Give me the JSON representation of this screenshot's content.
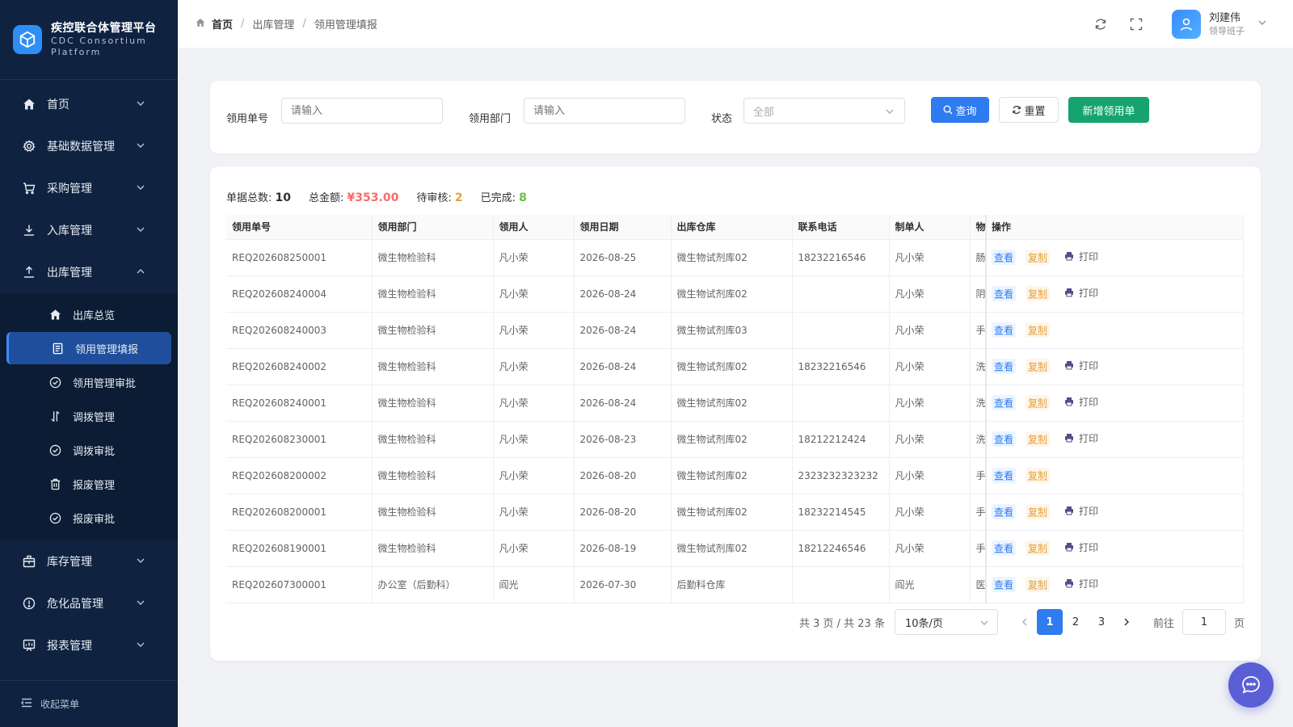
{
  "brand": {
    "title": "疾控联合体管理平台",
    "subtitle_line1": "CDC Consortium",
    "subtitle_line2": "Platform",
    "icon": "cube-icon"
  },
  "sidebar": {
    "items": [
      {
        "label": "首页",
        "icon": "home-icon"
      },
      {
        "label": "基础数据管理",
        "icon": "gear-icon"
      },
      {
        "label": "采购管理",
        "icon": "cart-icon"
      },
      {
        "label": "入库管理",
        "icon": "download-icon"
      },
      {
        "label": "出库管理",
        "icon": "upload-icon"
      }
    ],
    "sub_items": [
      {
        "label": "出库总览",
        "icon": "home-icon"
      },
      {
        "label": "领用管理填报",
        "icon": "form-icon",
        "active": true
      },
      {
        "label": "领用管理审批",
        "icon": "check-circle-icon"
      },
      {
        "label": "调拨管理",
        "icon": "transfer-icon"
      },
      {
        "label": "调拨审批",
        "icon": "check-circle-icon"
      },
      {
        "label": "报废管理",
        "icon": "trash-icon"
      },
      {
        "label": "报废审批",
        "icon": "check-circle-icon"
      }
    ],
    "items_after": [
      {
        "label": "库存管理",
        "icon": "box-icon"
      },
      {
        "label": "危化品管理",
        "icon": "warning-icon"
      },
      {
        "label": "报表管理",
        "icon": "chart-icon"
      }
    ],
    "collapse_label": "收起菜单"
  },
  "header": {
    "breadcrumb": [
      "首页",
      "出库管理",
      "领用管理填报"
    ],
    "user_name": "刘建伟",
    "user_role": "领导班子"
  },
  "filter": {
    "order_no_label": "领用单号",
    "order_no_placeholder": "请输入",
    "dept_label": "领用部门",
    "dept_placeholder": "请输入",
    "status_label": "状态",
    "status_value": "全部",
    "query_label": "查询",
    "reset_label": "重置",
    "new_label": "新增领用单"
  },
  "stats": {
    "total_label": "单据总数:",
    "total_value": "10",
    "amount_label": "总金额:",
    "amount_value": "¥353.00",
    "pending_label": "待审核:",
    "pending_value": "2",
    "done_label": "已完成:",
    "done_value": "8"
  },
  "table": {
    "columns": [
      "领用单号",
      "领用部门",
      "领用人",
      "领用日期",
      "出库仓库",
      "联系电话",
      "制单人",
      "物",
      "操作"
    ],
    "view_label": "查看",
    "copy_label": "复制",
    "print_label": "打印",
    "rows": [
      {
        "no": "REQ202608250001",
        "dept": "微生物检验科",
        "person": "凡小荣",
        "date": "2026-08-25",
        "warehouse": "微生物试剂库02",
        "phone": "18232216546",
        "maker": "凡小荣",
        "item": "肠",
        "print": true
      },
      {
        "no": "REQ202608240004",
        "dept": "微生物检验科",
        "person": "凡小荣",
        "date": "2026-08-24",
        "warehouse": "微生物试剂库02",
        "phone": "",
        "maker": "凡小荣",
        "item": "阴",
        "print": true
      },
      {
        "no": "REQ202608240003",
        "dept": "微生物检验科",
        "person": "凡小荣",
        "date": "2026-08-24",
        "warehouse": "微生物试剂库03",
        "phone": "",
        "maker": "凡小荣",
        "item": "手",
        "print": false
      },
      {
        "no": "REQ202608240002",
        "dept": "微生物检验科",
        "person": "凡小荣",
        "date": "2026-08-24",
        "warehouse": "微生物试剂库02",
        "phone": "18232216546",
        "maker": "凡小荣",
        "item": "洗",
        "print": true
      },
      {
        "no": "REQ202608240001",
        "dept": "微生物检验科",
        "person": "凡小荣",
        "date": "2026-08-24",
        "warehouse": "微生物试剂库02",
        "phone": "",
        "maker": "凡小荣",
        "item": "洗",
        "print": true
      },
      {
        "no": "REQ202608230001",
        "dept": "微生物检验科",
        "person": "凡小荣",
        "date": "2026-08-23",
        "warehouse": "微生物试剂库02",
        "phone": "18212212424",
        "maker": "凡小荣",
        "item": "洗",
        "print": true
      },
      {
        "no": "REQ202608200002",
        "dept": "微生物检验科",
        "person": "凡小荣",
        "date": "2026-08-20",
        "warehouse": "微生物试剂库02",
        "phone": "2323232323232",
        "maker": "凡小荣",
        "item": "手",
        "print": false
      },
      {
        "no": "REQ202608200001",
        "dept": "微生物检验科",
        "person": "凡小荣",
        "date": "2026-08-20",
        "warehouse": "微生物试剂库02",
        "phone": "18232214545",
        "maker": "凡小荣",
        "item": "手",
        "print": true
      },
      {
        "no": "REQ202608190001",
        "dept": "微生物检验科",
        "person": "凡小荣",
        "date": "2026-08-19",
        "warehouse": "微生物试剂库02",
        "phone": "18212246546",
        "maker": "凡小荣",
        "item": "手",
        "print": true
      },
      {
        "no": "REQ202607300001",
        "dept": "办公室（后勤科）",
        "person": "阎光",
        "date": "2026-07-30",
        "warehouse": "后勤科仓库",
        "phone": "",
        "maker": "阎光",
        "item": "医",
        "print": true
      }
    ]
  },
  "pagination": {
    "total_text": "共 3 页 / 共 23 条",
    "page_size": "10条/页",
    "pages": [
      "1",
      "2",
      "3"
    ],
    "current": "1",
    "goto_label": "前往",
    "goto_value": "1",
    "unit_label": "页"
  },
  "colors": {
    "sidebar_bg": "#0f2340",
    "primary": "#2f7bf0",
    "success": "#16a36f",
    "chat_fab": "#5b5fd6"
  }
}
